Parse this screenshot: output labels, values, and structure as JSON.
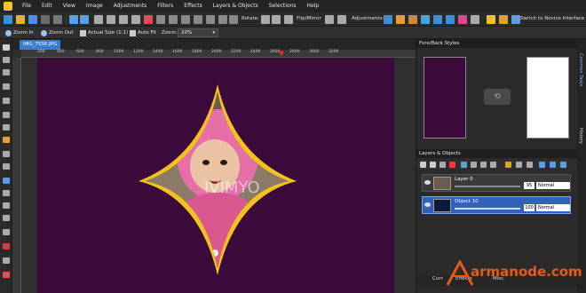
{
  "menu": [
    "File",
    "Edit",
    "View",
    "Image",
    "Adjustments",
    "Filters",
    "Effects",
    "Layers & Objects",
    "Selections",
    "Help"
  ],
  "toolbar": {
    "rotate_label": "Rotate:",
    "flip_label": "Flip/Mirror",
    "adjustments_label": "Adjustments:",
    "switch_label": "Switch to Novice Interface"
  },
  "options": {
    "zoom_in": "Zoom In",
    "zoom_out": "Zoom Out",
    "actual_size": "Actual Size (1:1)",
    "auto_fit": "Auto Fit",
    "zoom_label": "Zoom:",
    "zoom_value": "20%"
  },
  "document": {
    "tab_title": "IMG_7556.JPG",
    "ruler_ticks": [
      "100",
      "200",
      "400",
      "600",
      "800",
      "1000",
      "1200",
      "1400",
      "1600",
      "1800",
      "2000",
      "2200",
      "2400",
      "2600",
      "2800",
      "3000",
      "3200"
    ],
    "canvas_color": "#3c0a3a",
    "watermark_text": "IVIMYO"
  },
  "panels": {
    "foreback": {
      "title": "Fore/Back Styles",
      "fore_color": "#3c0a3a",
      "back_color": "#ffffff"
    },
    "layers": {
      "title": "Layers & Objects",
      "rows": [
        {
          "name": "Layer 0",
          "opacity": "95",
          "mode": "Normal",
          "selected": false
        },
        {
          "name": "Object 10",
          "opacity": "100",
          "mode": "Normal",
          "selected": true
        }
      ]
    },
    "bottom_tabs": [
      "Curr",
      "Effects",
      "Misc."
    ],
    "side_tabs": [
      "History",
      "Common Tasks"
    ]
  },
  "brand": {
    "text": "armanode.com",
    "color": "#e25a1c"
  }
}
